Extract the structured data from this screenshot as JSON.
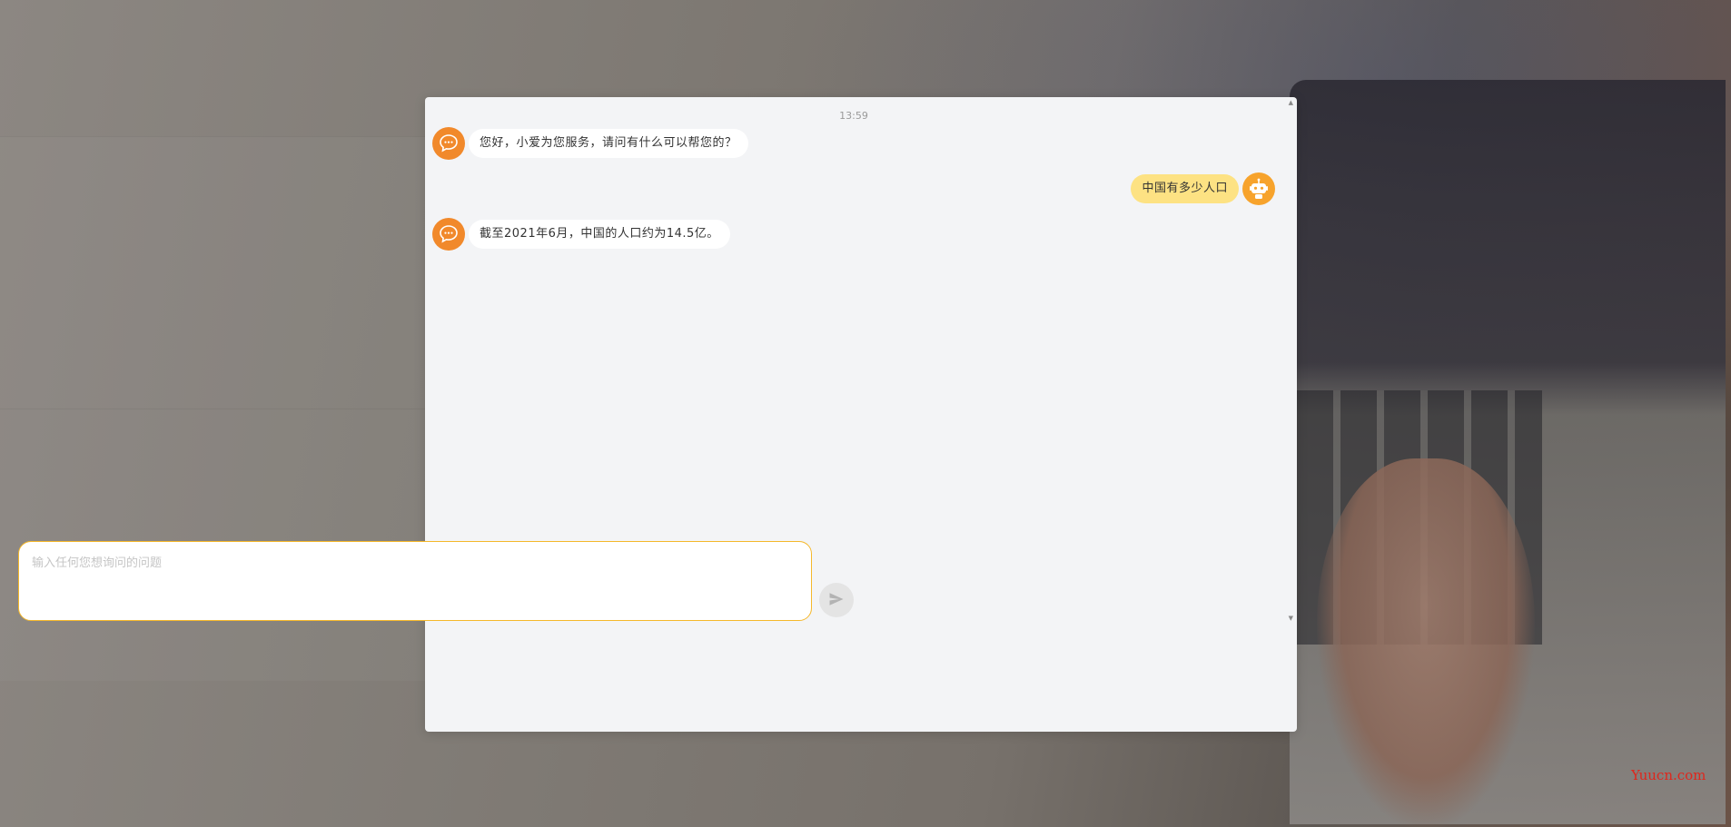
{
  "chat": {
    "timestamp": "13:59",
    "messages": [
      {
        "role": "bot",
        "text": "您好，小爱为您服务，请问有什么可以帮您的？"
      },
      {
        "role": "user",
        "text": "中国有多少人口"
      },
      {
        "role": "bot",
        "text": "截至2021年6月，中国的人口约为14.5亿。"
      }
    ]
  },
  "input": {
    "placeholder": "输入任何您想询问的问题",
    "value": ""
  },
  "watermark": "Yuucn.com",
  "colors": {
    "bot_avatar": "#f1892b",
    "user_avatar": "#f7a32c",
    "user_bubble": "#fde283",
    "input_border": "#f5b82b"
  },
  "icons": {
    "bot_avatar": "chat-bubble-icon",
    "user_avatar": "robot-icon",
    "send": "send-icon"
  }
}
